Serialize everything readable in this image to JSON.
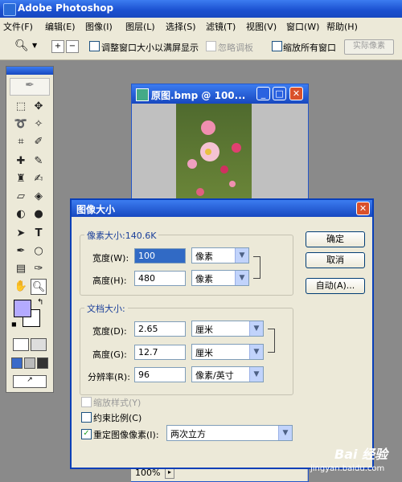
{
  "app": {
    "title": "Adobe Photoshop"
  },
  "menu": [
    "文件(F)",
    "编辑(E)",
    "图像(I)",
    "图层(L)",
    "选择(S)",
    "滤镜(T)",
    "视图(V)",
    "窗口(W)",
    "帮助(H)"
  ],
  "options": {
    "resize_window": "调整窗口大小以满屏显示",
    "ignore_palettes": "忽略调板",
    "zoom_all": "缩放所有窗口",
    "actual_pixels": "实际像素"
  },
  "image_window": {
    "title": "原图.bmp @ 100...",
    "zoom": "100%"
  },
  "dialog": {
    "title": "图像大小",
    "pixel_dims": {
      "label": "像素大小:140.6K",
      "width_label": "宽度(W):",
      "width_value": "100",
      "width_unit": "像素",
      "height_label": "高度(H):",
      "height_value": "480",
      "height_unit": "像素"
    },
    "doc_size": {
      "label": "文档大小:",
      "width_label": "宽度(D):",
      "width_value": "2.65",
      "width_unit": "厘米",
      "height_label": "高度(G):",
      "height_value": "12.7",
      "height_unit": "厘米",
      "res_label": "分辨率(R):",
      "res_value": "96",
      "res_unit": "像素/英寸"
    },
    "scale_styles": "缩放样式(Y)",
    "constrain": "约束比例(C)",
    "resample": "重定图像像素(I):",
    "resample_method": "两次立方",
    "ok": "确定",
    "cancel": "取消",
    "auto": "自动(A)..."
  },
  "watermark": {
    "text": "Bai 经验",
    "url": "jingyan.baidu.com"
  },
  "colors": {
    "title_blue": "#1748c0",
    "face": "#ece9d8",
    "close_red": "#d9502b",
    "foreground": "#b4aaff"
  }
}
